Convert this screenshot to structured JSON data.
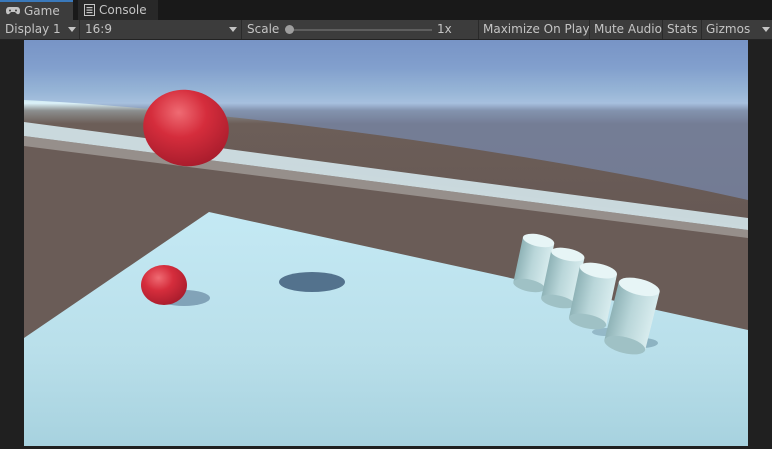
{
  "tabs": [
    {
      "label": "Game",
      "icon": "gamepad-icon",
      "active": true
    },
    {
      "label": "Console",
      "icon": "console-icon",
      "active": false
    }
  ],
  "toolbar": {
    "display_label": "Display 1",
    "aspect_label": "16:9",
    "scale_label": "Scale",
    "scale_value": "1x",
    "scale_slider_level": 0.0,
    "maximize_label": "Maximize On Play",
    "mute_label": "Mute Audio",
    "stats_label": "Stats",
    "gizmos_label": "Gizmos"
  },
  "scene": {
    "sky_top_color": "#7391c3",
    "horizon_color": "#d8f2fa",
    "ground_color": "#6c5e58",
    "plane_color": "#bfe4ef",
    "sphere_color": "#d52d3c",
    "cylinder_color": "#b6d3d6",
    "shadow_color": "#4d6c87",
    "objects": [
      "floating-sphere",
      "ground-sphere",
      "shadow-disc",
      "cylinder-1",
      "cylinder-2",
      "cylinder-3",
      "cylinder-4"
    ]
  }
}
